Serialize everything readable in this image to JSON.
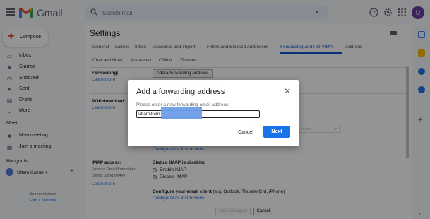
{
  "topbar": {
    "brand": "Gmail",
    "search_placeholder": "Search mail",
    "avatar_initial": "U"
  },
  "sidebar": {
    "compose_label": "Compose",
    "items": [
      {
        "label": "Inbox",
        "icon": "inbox-icon"
      },
      {
        "label": "Starred",
        "icon": "star-icon"
      },
      {
        "label": "Snoozed",
        "icon": "clock-icon"
      },
      {
        "label": "Sent",
        "icon": "send-icon"
      },
      {
        "label": "Drafts",
        "icon": "draft-icon"
      },
      {
        "label": "More",
        "icon": "chevron-down-icon"
      }
    ],
    "meet_heading": "Meet",
    "meet_items": [
      {
        "label": "New meeting",
        "icon": "video-icon"
      },
      {
        "label": "Join a meeting",
        "icon": "keyboard-icon"
      }
    ],
    "hangouts_heading": "Hangouts",
    "hangouts_user": "Uttam Kumar",
    "no_chats": "No recent chats",
    "start_chat": "Start a new one"
  },
  "main": {
    "title": "Settings",
    "tabs_row1": [
      "General",
      "Labels",
      "Inbox",
      "Accounts and Import",
      "Filters and Blocked Addresses",
      "Forwarding and POP/IMAP",
      "Add-ons"
    ],
    "active_tab": "Forwarding and POP/IMAP",
    "tabs_row2": [
      "Chat and Meet",
      "Advanced",
      "Offline",
      "Themes"
    ],
    "forwarding_label": "Forwarding:",
    "learn_more": "Learn more",
    "add_forwarding_button": "Add a forwarding address",
    "pop_label": "POP download:",
    "config_instructions": "Configuration instructions",
    "imap_label": "IMAP access:",
    "imap_sub": "(access Gmail from other clients using IMAP)",
    "imap_status": "Status: IMAP is disabled",
    "enable_imap": "Enable IMAP",
    "disable_imap": "Disable IMAP",
    "configure_client_bold": "Configure your email client",
    "configure_client_rest": " (e.g. Outlook, Thunderbird, iPhone)",
    "save_changes": "Save Changes",
    "cancel": "Cancel",
    "ghost_select_text": "Inbox"
  },
  "dialog": {
    "title": "Add a forwarding address",
    "prompt": "Please enter a new forwarding email address:",
    "input_value": "uttam.kum",
    "cancel": "Cancel",
    "next": "Next"
  },
  "colors": {
    "accent": "#1a73e8",
    "gmail_red": "#ea4335",
    "avatar": "#6b3fa0",
    "redaction": "#6d9eeb"
  }
}
